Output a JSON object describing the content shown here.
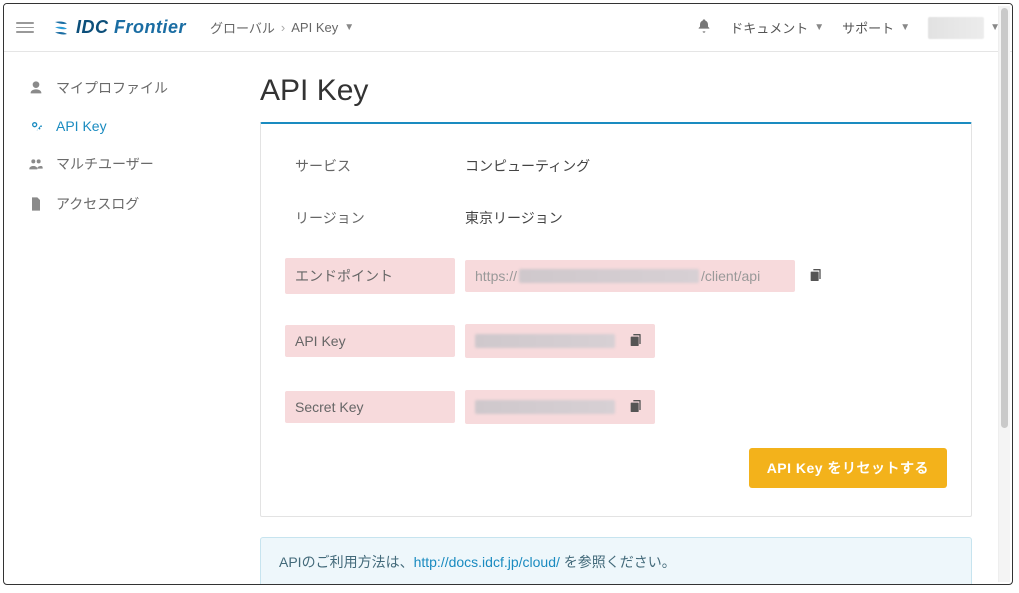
{
  "header": {
    "brand_prefix": "IDC",
    "brand_suffix": "Frontier",
    "breadcrumb_root": "グローバル",
    "breadcrumb_current": "API Key",
    "documents_label": "ドキュメント",
    "support_label": "サポート"
  },
  "sidebar": {
    "items": [
      {
        "label": "マイプロファイル"
      },
      {
        "label": "API Key"
      },
      {
        "label": "マルチユーザー"
      },
      {
        "label": "アクセスログ"
      }
    ]
  },
  "page": {
    "title": "API Key",
    "service_label": "サービス",
    "service_value": "コンピューティング",
    "region_label": "リージョン",
    "region_value": "東京リージョン",
    "endpoint_label": "エンドポイント",
    "endpoint_prefix": "https://",
    "endpoint_suffix": "/client/api",
    "apikey_label": "API Key",
    "secret_label": "Secret Key",
    "reset_button": "API Key をリセットする",
    "info_prefix": "APIのご利用方法は、",
    "info_link": "http://docs.idcf.jp/cloud/",
    "info_suffix": " を参照ください。"
  }
}
